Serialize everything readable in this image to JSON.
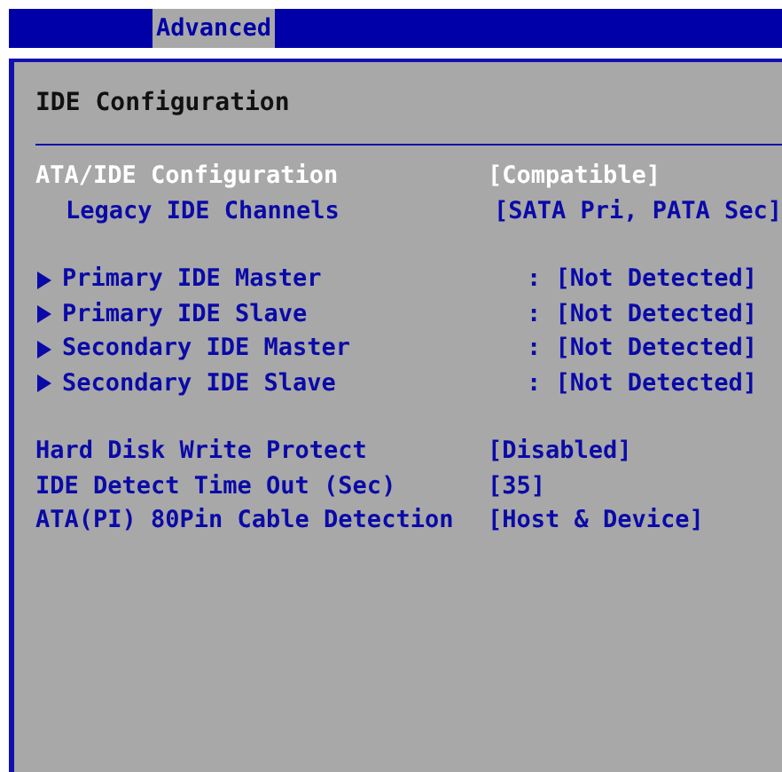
{
  "tabs": [
    {
      "label": "Advanced",
      "selected": true
    }
  ],
  "panel": {
    "title": "IDE Configuration",
    "groups": [
      [
        {
          "kind": "setting",
          "label": "ATA/IDE Configuration",
          "value": "[Compatible]",
          "selected": true
        },
        {
          "kind": "subsetting",
          "label": "Legacy IDE Channels",
          "value": "[SATA Pri, PATA Sec]",
          "selected": false
        }
      ],
      [
        {
          "kind": "submenu",
          "label": "Primary IDE Master",
          "value": ": [Not Detected]",
          "selected": false
        },
        {
          "kind": "submenu",
          "label": "Primary IDE Slave",
          "value": ": [Not Detected]",
          "selected": false
        },
        {
          "kind": "submenu",
          "label": "Secondary IDE Master",
          "value": ": [Not Detected]",
          "selected": false
        },
        {
          "kind": "submenu",
          "label": "Secondary IDE Slave",
          "value": ": [Not Detected]",
          "selected": false
        }
      ],
      [
        {
          "kind": "setting",
          "label": "Hard Disk Write Protect",
          "value": "[Disabled]",
          "selected": false
        },
        {
          "kind": "setting",
          "label": "IDE Detect Time Out (Sec)",
          "value": "[35]",
          "selected": false
        },
        {
          "kind": "setting",
          "label": "ATA(PI) 80Pin Cable Detection",
          "value": "[Host & Device]",
          "selected": false
        }
      ]
    ]
  }
}
